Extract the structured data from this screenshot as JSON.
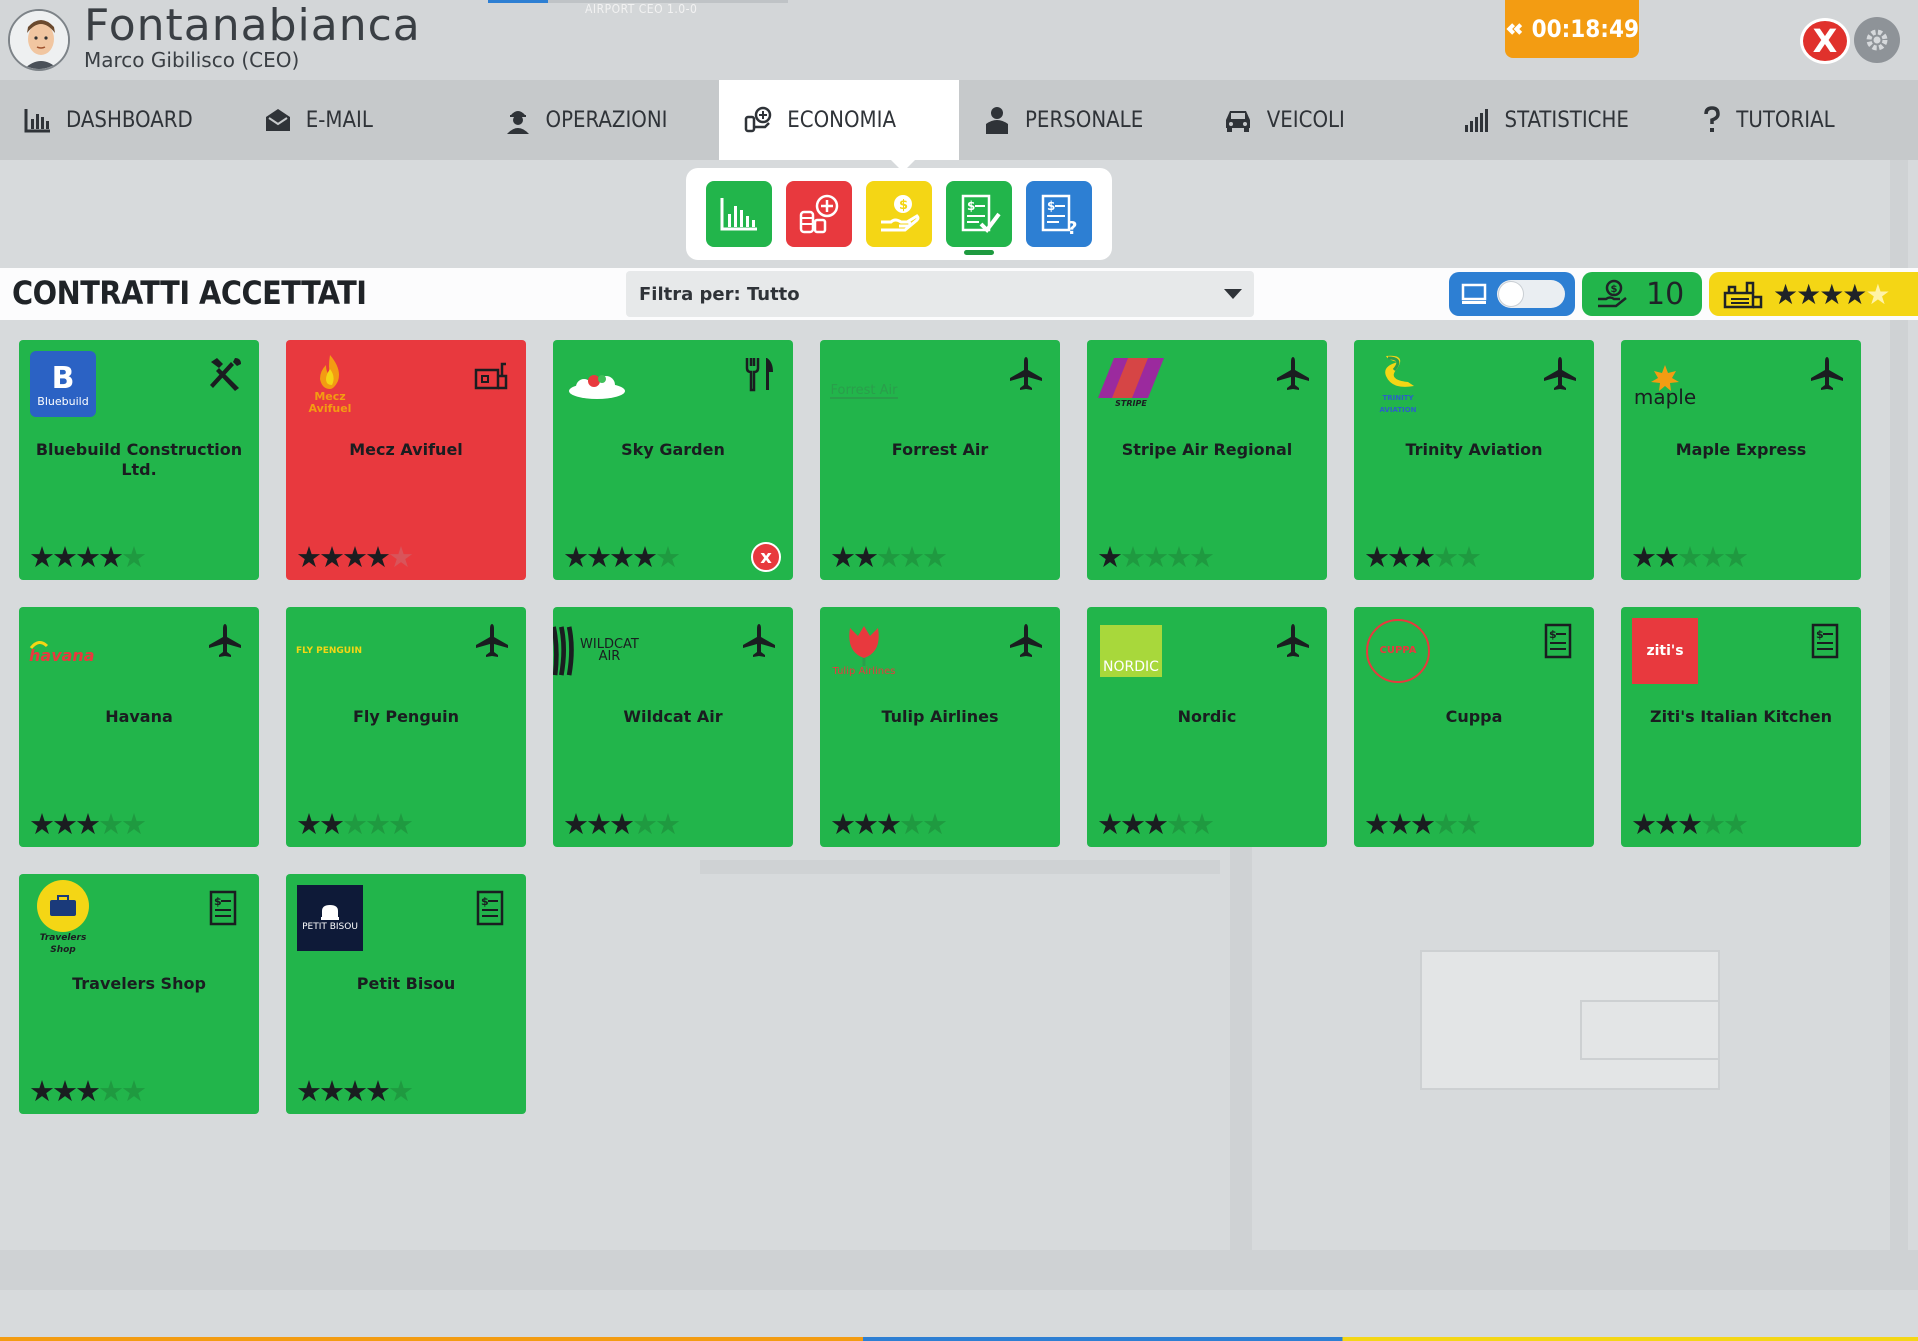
{
  "header": {
    "airport_name": "Fontanabianca",
    "ceo_name": "Marco Gibilisco (CEO)",
    "version": "AIRPORT CEO  1.0-0",
    "timer": "00:18:49",
    "close_label": "X"
  },
  "nav": {
    "items": [
      {
        "label": "DASHBOARD",
        "icon": "bar-chart-icon"
      },
      {
        "label": "E-MAIL",
        "icon": "envelope-icon"
      },
      {
        "label": "OPERAZIONI",
        "icon": "worker-icon"
      },
      {
        "label": "ECONOMIA",
        "icon": "money-icon"
      },
      {
        "label": "PERSONALE",
        "icon": "person-icon"
      },
      {
        "label": "VEICOLI",
        "icon": "car-icon"
      },
      {
        "label": "STATISTICHE",
        "icon": "signal-icon"
      },
      {
        "label": "TUTORIAL",
        "icon": "question-icon"
      }
    ],
    "active_index": 3
  },
  "submenu": {
    "buttons": [
      {
        "name": "overview-chart",
        "color": "#22b54b"
      },
      {
        "name": "loans",
        "color": "#e8393e"
      },
      {
        "name": "investments",
        "color": "#f4d615"
      },
      {
        "name": "accepted-contracts",
        "color": "#22b54b"
      },
      {
        "name": "contract-offers",
        "color": "#2d7fd3"
      }
    ],
    "active": "accepted-contracts"
  },
  "titlebar": {
    "title": "CONTRATTI ACCETTATI",
    "filter": "Filtra per: Tutto",
    "count": "10",
    "stars_text": "★★★★",
    "stars_dim": "★"
  },
  "colors": {
    "green": "#22b54b",
    "red": "#e8393e",
    "yellow": "#f4d615",
    "blue": "#2d7fd3",
    "orange": "#f39c12"
  },
  "contracts": [
    {
      "name": "Bluebuild Construction Ltd.",
      "type": "construction",
      "stars": 4,
      "color": "green",
      "logo": "Bluebuild"
    },
    {
      "name": "Mecz Avifuel",
      "type": "fuel",
      "stars": 4,
      "color": "red",
      "logo": "Mecz Avifuel"
    },
    {
      "name": "Sky Garden",
      "type": "food",
      "stars": 4,
      "color": "green",
      "logo": "",
      "removable": true
    },
    {
      "name": "Forrest Air",
      "type": "airline",
      "stars": 2,
      "color": "green",
      "logo": "Forrest Air"
    },
    {
      "name": "Stripe Air Regional",
      "type": "airline",
      "stars": 1,
      "color": "green",
      "logo": "STRIPE"
    },
    {
      "name": "Trinity Aviation",
      "type": "airline",
      "stars": 3,
      "color": "green",
      "logo": "TRINITY AVIATION"
    },
    {
      "name": "Maple Express",
      "type": "airline",
      "stars": 2,
      "color": "green",
      "logo": "maple"
    },
    {
      "name": "Havana",
      "type": "airline",
      "stars": 3,
      "color": "green",
      "logo": "havana"
    },
    {
      "name": "Fly Penguin",
      "type": "airline",
      "stars": 2,
      "color": "green",
      "logo": "FLY PENGUIN"
    },
    {
      "name": "Wildcat Air",
      "type": "airline",
      "stars": 3,
      "color": "green",
      "logo": "WILDCAT AIR"
    },
    {
      "name": "Tulip Airlines",
      "type": "airline",
      "stars": 3,
      "color": "green",
      "logo": "Tulip Airlines"
    },
    {
      "name": "Nordic",
      "type": "airline",
      "stars": 3,
      "color": "green",
      "logo": "NORDIC"
    },
    {
      "name": "Cuppa",
      "type": "contract",
      "stars": 3,
      "color": "green",
      "logo": "CUPPA"
    },
    {
      "name": "Ziti's Italian Kitchen",
      "type": "contract",
      "stars": 3,
      "color": "green",
      "logo": "ziti's"
    },
    {
      "name": "Travelers Shop",
      "type": "contract",
      "stars": 3,
      "color": "green",
      "logo": "Travelers Shop"
    },
    {
      "name": "Petit Bisou",
      "type": "contract",
      "stars": 4,
      "color": "green",
      "logo": "PETIT BISOU"
    }
  ]
}
